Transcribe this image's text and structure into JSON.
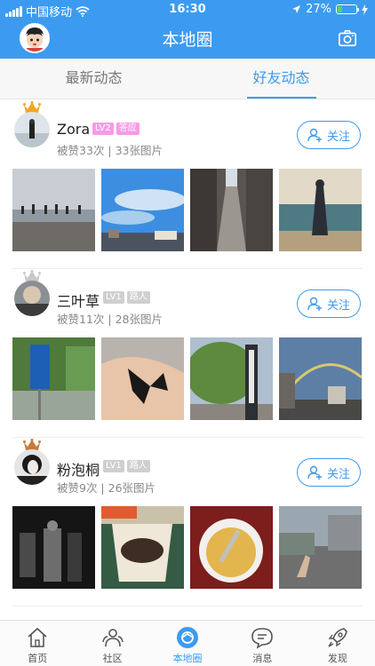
{
  "status_bar": {
    "carrier": "中国移动",
    "time": "16:30",
    "battery": "27%",
    "battery_level": 0.27
  },
  "nav": {
    "title": "本地圈"
  },
  "tabs": [
    {
      "label": "最新动态",
      "active": false
    },
    {
      "label": "好友动态",
      "active": true
    }
  ],
  "posts": [
    {
      "name": "Zora",
      "badges": [
        {
          "text": "LV2",
          "color": "#f79be5"
        },
        {
          "text": "答应",
          "color": "#f79be5"
        }
      ],
      "stats": "被赞33次 | 33张图片",
      "follow_label": "关注",
      "photos": [
        "seaside-crowd",
        "blue-sky-city",
        "alley",
        "beach-woman"
      ]
    },
    {
      "name": "三叶草",
      "badges": [
        {
          "text": "LV1",
          "color": "#cfcfcf"
        },
        {
          "text": "路人",
          "color": "#cfcfcf"
        }
      ],
      "stats": "被赞11次 | 28张图片",
      "follow_label": "关注",
      "photos": [
        "road-sign",
        "butterfly-hand",
        "tree-street",
        "rainbow"
      ]
    },
    {
      "name": "粉泡桐",
      "badges": [
        {
          "text": "LV1",
          "color": "#cfcfcf"
        },
        {
          "text": "路人",
          "color": "#cfcfcf"
        }
      ],
      "stats": "被赞9次 | 26张图片",
      "follow_label": "关注",
      "photos": [
        "dark-concert",
        "coffee-pack",
        "tea-cup",
        "peace-sign"
      ]
    }
  ],
  "bottom_nav": [
    {
      "label": "首页",
      "icon": "home-icon",
      "active": false
    },
    {
      "label": "社区",
      "icon": "community-icon",
      "active": false
    },
    {
      "label": "本地圈",
      "icon": "local-circle-icon",
      "active": true
    },
    {
      "label": "消息",
      "icon": "message-icon",
      "active": false
    },
    {
      "label": "发现",
      "icon": "rocket-icon",
      "active": false
    }
  ],
  "colors": {
    "primary": "#3c9bf0",
    "vip_badge": "#f79be5",
    "normal_badge": "#cfcfcf"
  }
}
